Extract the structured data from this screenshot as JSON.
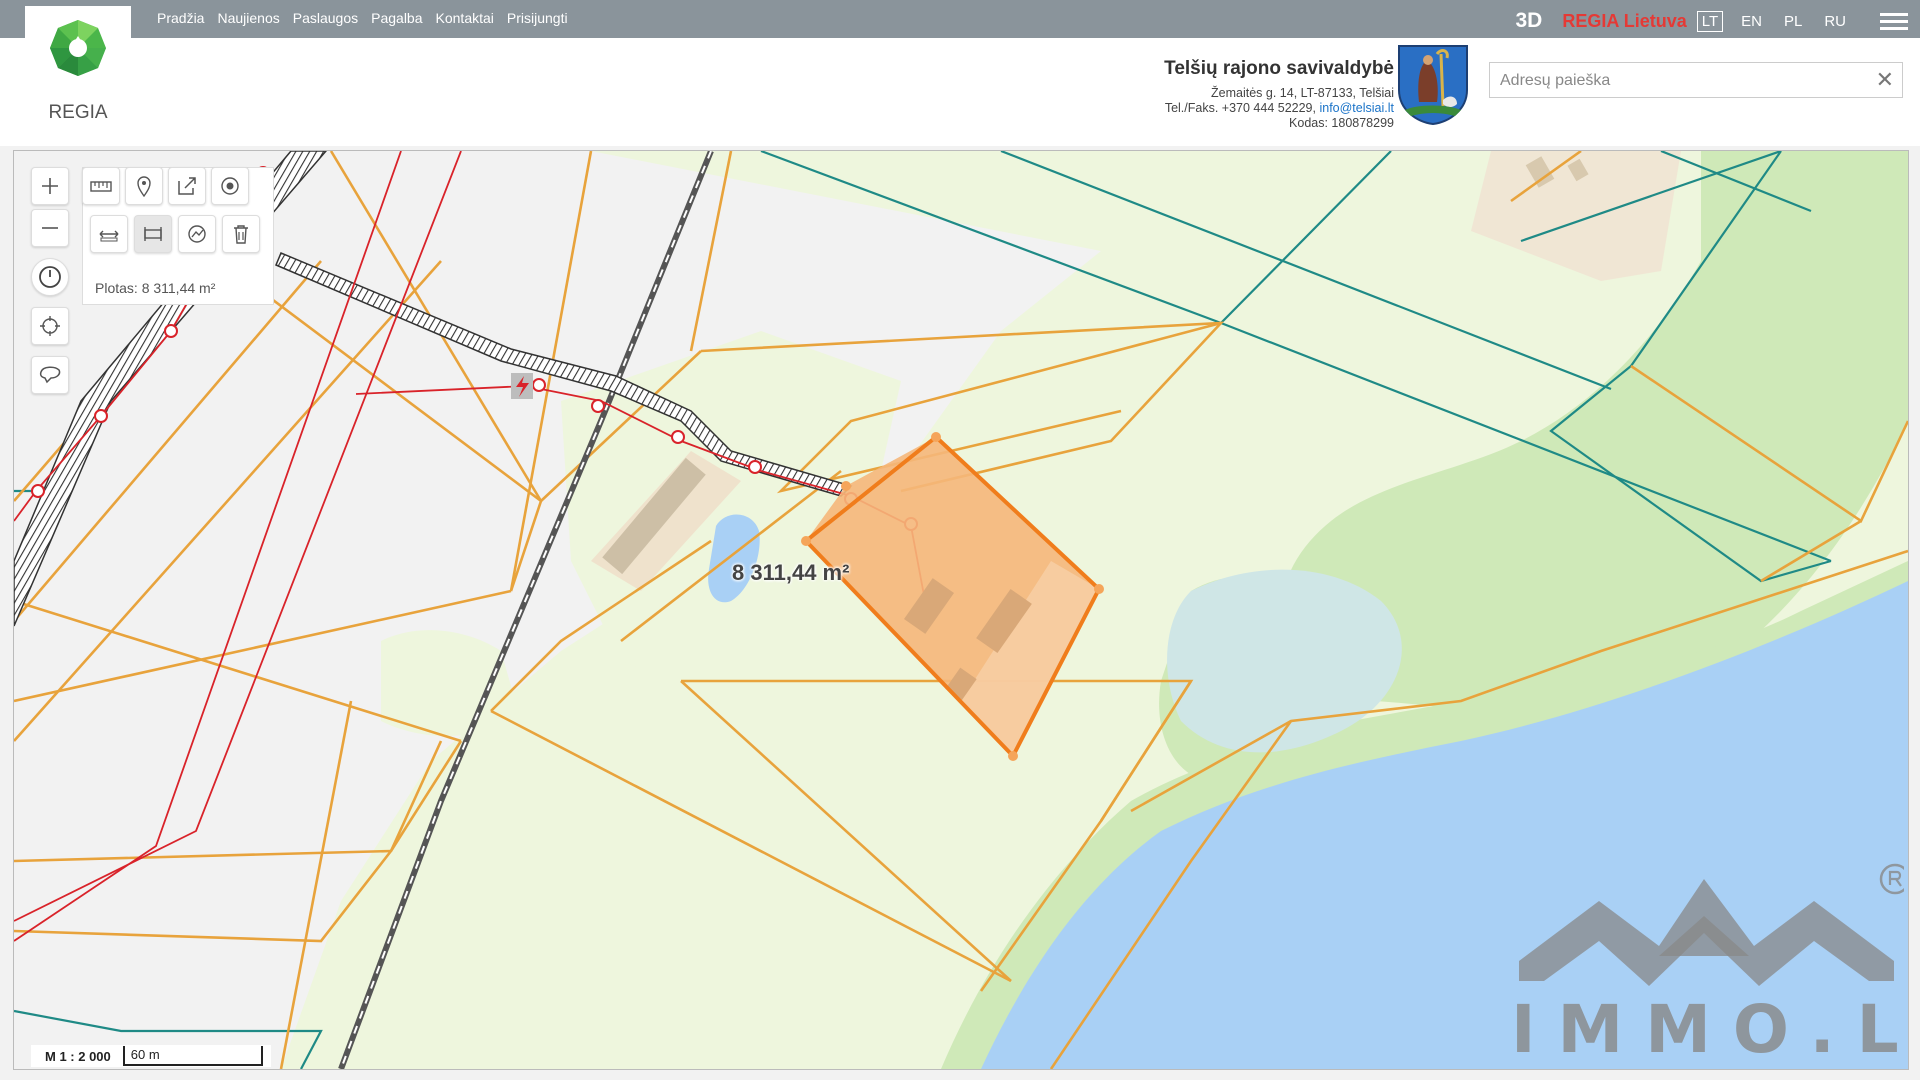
{
  "nav": {
    "items": [
      "Pradžia",
      "Naujienos",
      "Paslaugos",
      "Pagalba",
      "Kontaktai",
      "Prisijungti"
    ]
  },
  "topbar": {
    "btn_3d": "3D",
    "regia_lietuva": "REGIA Lietuva",
    "languages": [
      "LT",
      "EN",
      "PL",
      "RU"
    ],
    "active_language": "LT"
  },
  "logo": {
    "text": "REGIA"
  },
  "municipality": {
    "name": "Telšių rajono savivaldybė",
    "address": "Žemaitės g. 14, LT-87133, Telšiai",
    "phone": "Tel./Faks. +370 444 52229,",
    "email": "info@telsiai.lt",
    "code": "Kodas: 180878299"
  },
  "search": {
    "placeholder": "Adresų paieška",
    "value": ""
  },
  "measure": {
    "area_info": "Plotas: 8 311,44 m²",
    "area_label": "8 311,44 m²"
  },
  "scale": {
    "ratio": "M 1 : 2 000",
    "bar_label": "60 m"
  },
  "watermark": {
    "text": "IMMO.LT",
    "registered": "®"
  },
  "colors": {
    "topbar": "#8a949b",
    "parcel_orange": "#e8a33c",
    "selected_fill": "#f5b77a",
    "selected_stroke": "#f07d1c",
    "power_line": "#d9232a",
    "water": "#a9d0f5",
    "forest": "#cfe9b8",
    "meadow": "#eef6dd",
    "teal_boundary": "#1f8a86"
  },
  "icons": {
    "zoom_in": "plus-icon",
    "zoom_out": "minus-icon",
    "history": "clock-icon",
    "locate": "crosshair-icon",
    "region": "lasso-icon",
    "measure": "ruler-icon",
    "marker": "map-pin-icon",
    "share": "share-icon",
    "point": "target-icon",
    "distance": "measure-distance-icon",
    "area": "measure-area-icon",
    "profile": "profile-icon",
    "delete": "trash-icon"
  }
}
